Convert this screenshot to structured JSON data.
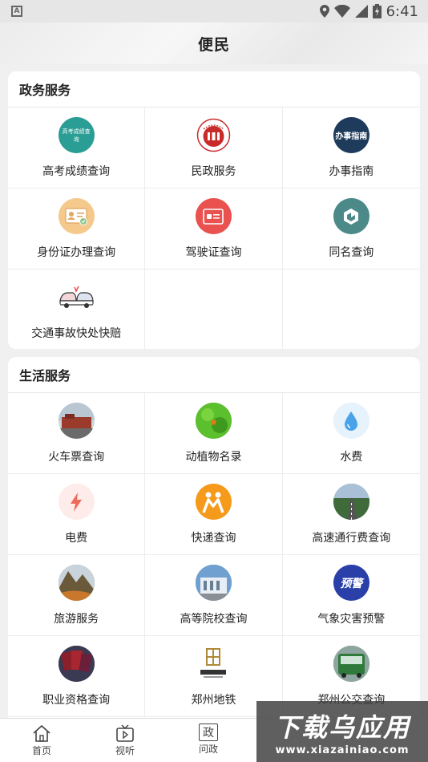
{
  "status_bar": {
    "left_badge": "A",
    "time": "6:41"
  },
  "header": {
    "title": "便民"
  },
  "gov_section": {
    "title": "政务服务",
    "items": [
      {
        "label": "高考成绩查询",
        "icon": "gaokao-icon",
        "color": "#2a9d94",
        "glyph": "高考成绩查询"
      },
      {
        "label": "民政服务",
        "icon": "civil-affairs-emblem-icon",
        "color": "#c92a2a",
        "glyph": "民"
      },
      {
        "label": "办事指南",
        "icon": "guide-icon",
        "color": "#1f3b5c",
        "glyph": "办事指南"
      },
      {
        "label": "身份证办理查询",
        "icon": "id-card-icon",
        "color": "#f5c98b",
        "glyph": ""
      },
      {
        "label": "驾驶证查询",
        "icon": "driver-license-icon",
        "color": "#e9524f",
        "glyph": ""
      },
      {
        "label": "同名查询",
        "icon": "same-name-icon",
        "color": "#4c8a8a",
        "glyph": ""
      },
      {
        "label": "交通事故快处快赔",
        "icon": "car-accident-icon",
        "color": "#ffffff",
        "glyph": ""
      }
    ]
  },
  "life_section": {
    "title": "生活服务",
    "items": [
      {
        "label": "火车票查询",
        "icon": "train-station-icon",
        "color": "#9b3b2c"
      },
      {
        "label": "动植物名录",
        "icon": "plant-butterfly-icon",
        "color": "#4caf2a"
      },
      {
        "label": "水费",
        "icon": "water-drop-icon",
        "color": "#e6f2fc"
      },
      {
        "label": "电费",
        "icon": "lightning-icon",
        "color": "#fdecea"
      },
      {
        "label": "快递查询",
        "icon": "courier-icon",
        "color": "#f59a1b"
      },
      {
        "label": "高速通行费查询",
        "icon": "highway-icon",
        "color": "#6f8ba5"
      },
      {
        "label": "旅游服务",
        "icon": "mountain-travel-icon",
        "color": "#8a6a3a"
      },
      {
        "label": "高等院校查询",
        "icon": "university-icon",
        "color": "#4a7fb0"
      },
      {
        "label": "气象灾害预警",
        "icon": "weather-warning-icon",
        "color": "#2a3fa8",
        "glyph": "预警"
      },
      {
        "label": "职业资格查询",
        "icon": "certificates-icon",
        "color": "#4a2a3a"
      },
      {
        "label": "郑州地铁",
        "icon": "zhengzhou-metro-icon",
        "color": "#b08a3a"
      },
      {
        "label": "郑州公交查询",
        "icon": "bus-icon",
        "color": "#2f6b3a"
      }
    ]
  },
  "tabbar": {
    "tabs": [
      {
        "label": "首页",
        "icon": "home-icon"
      },
      {
        "label": "视听",
        "icon": "tv-icon"
      },
      {
        "label": "问政",
        "icon": "politics-icon",
        "glyph": "政"
      }
    ]
  },
  "watermark": {
    "title": "下载乌应用",
    "url": "www.xiazainiao.com"
  }
}
